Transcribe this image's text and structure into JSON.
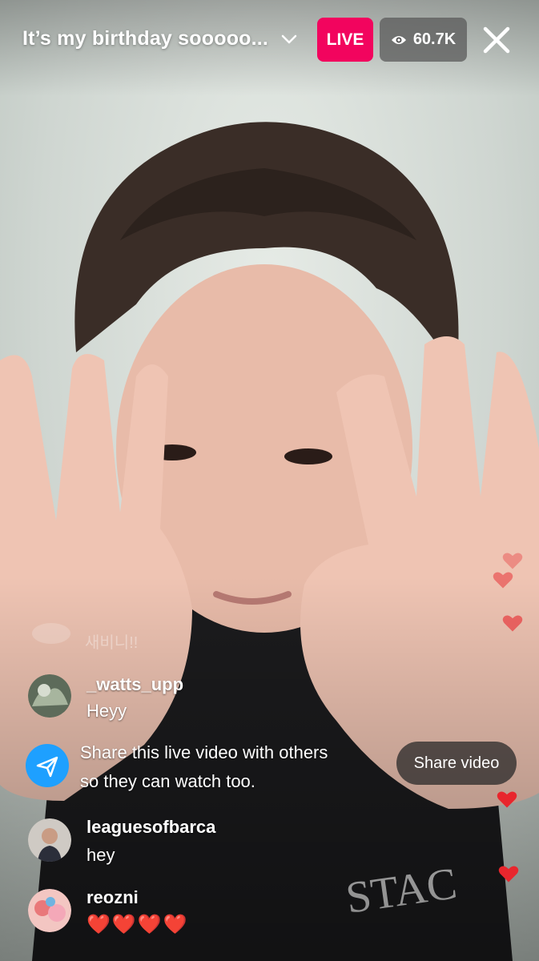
{
  "header": {
    "title": "It’s my birthday sooooo...",
    "live_label": "LIVE",
    "viewer_count": "60.7K"
  },
  "comments": [
    {
      "username": "_watts_upp",
      "text": "Heyy"
    },
    {
      "username": "leaguesofbarca",
      "text": "hey"
    },
    {
      "username": "reozni",
      "text": "❤️❤️❤️❤️"
    }
  ],
  "faded_comment": "새비니!!",
  "share_prompt": {
    "line1": "Share this live video with others",
    "line2": "so they can watch too.",
    "button_label": "Share video"
  },
  "colors": {
    "live": "#f2045e",
    "share_icon_bg": "#1ea0ff",
    "heart": "#e8262d"
  }
}
